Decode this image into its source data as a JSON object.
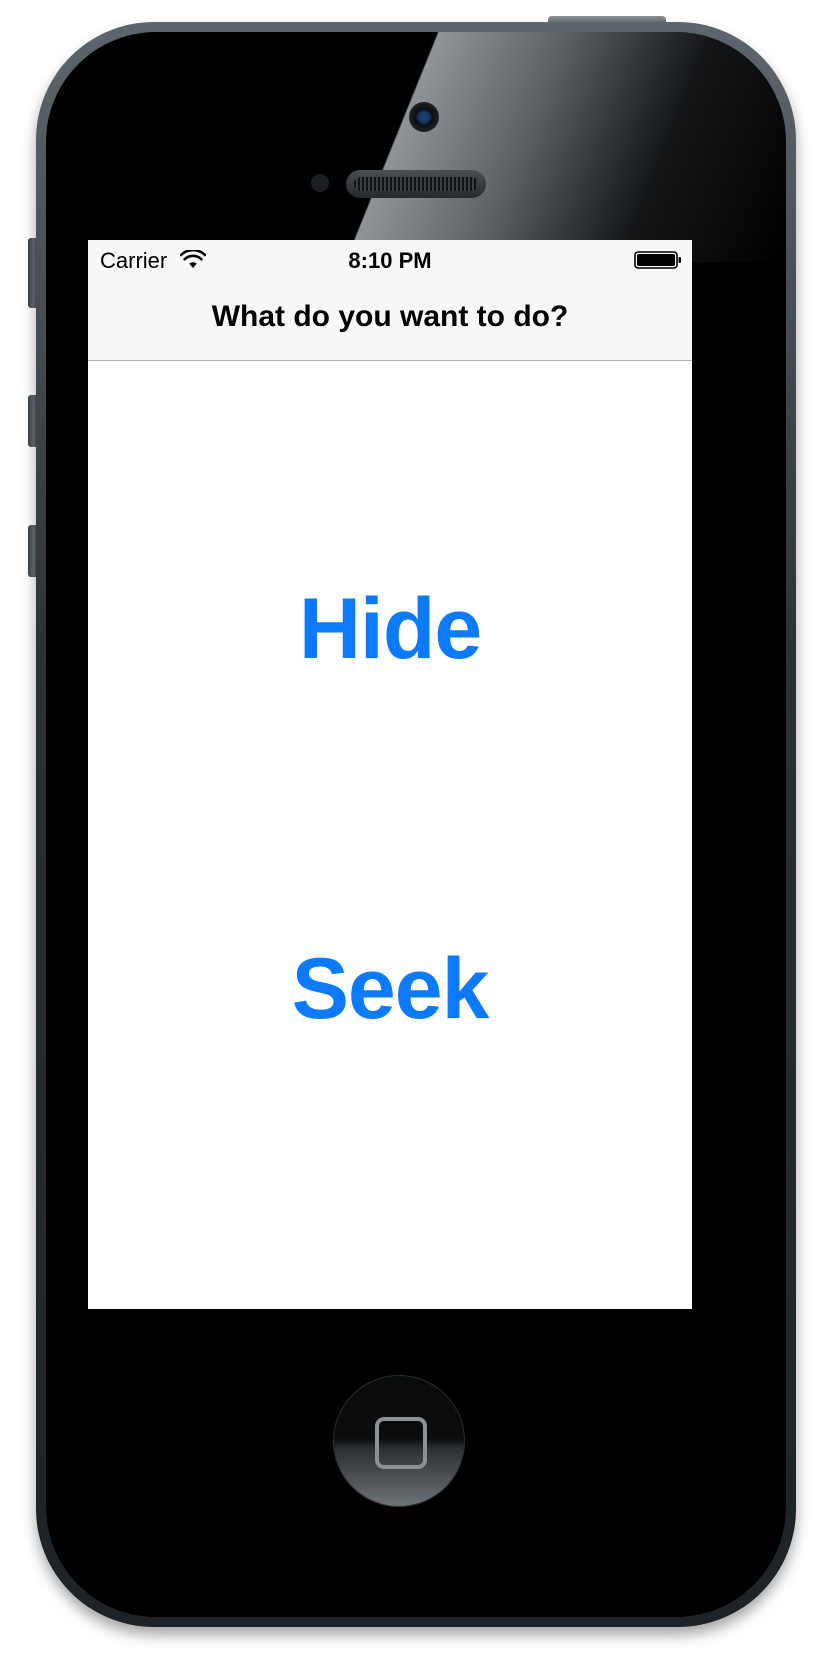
{
  "status_bar": {
    "carrier": "Carrier",
    "time": "8:10 PM"
  },
  "nav": {
    "title": "What do you want to do?"
  },
  "actions": {
    "hide_label": "Hide",
    "seek_label": "Seek"
  },
  "colors": {
    "accent": "#0b7aff",
    "navbar_bg": "#f7f7f7",
    "screen_bg": "#ffffff",
    "device_body": "#000000"
  },
  "icons": {
    "wifi": "wifi-icon",
    "battery": "battery-icon",
    "home": "home-button"
  }
}
